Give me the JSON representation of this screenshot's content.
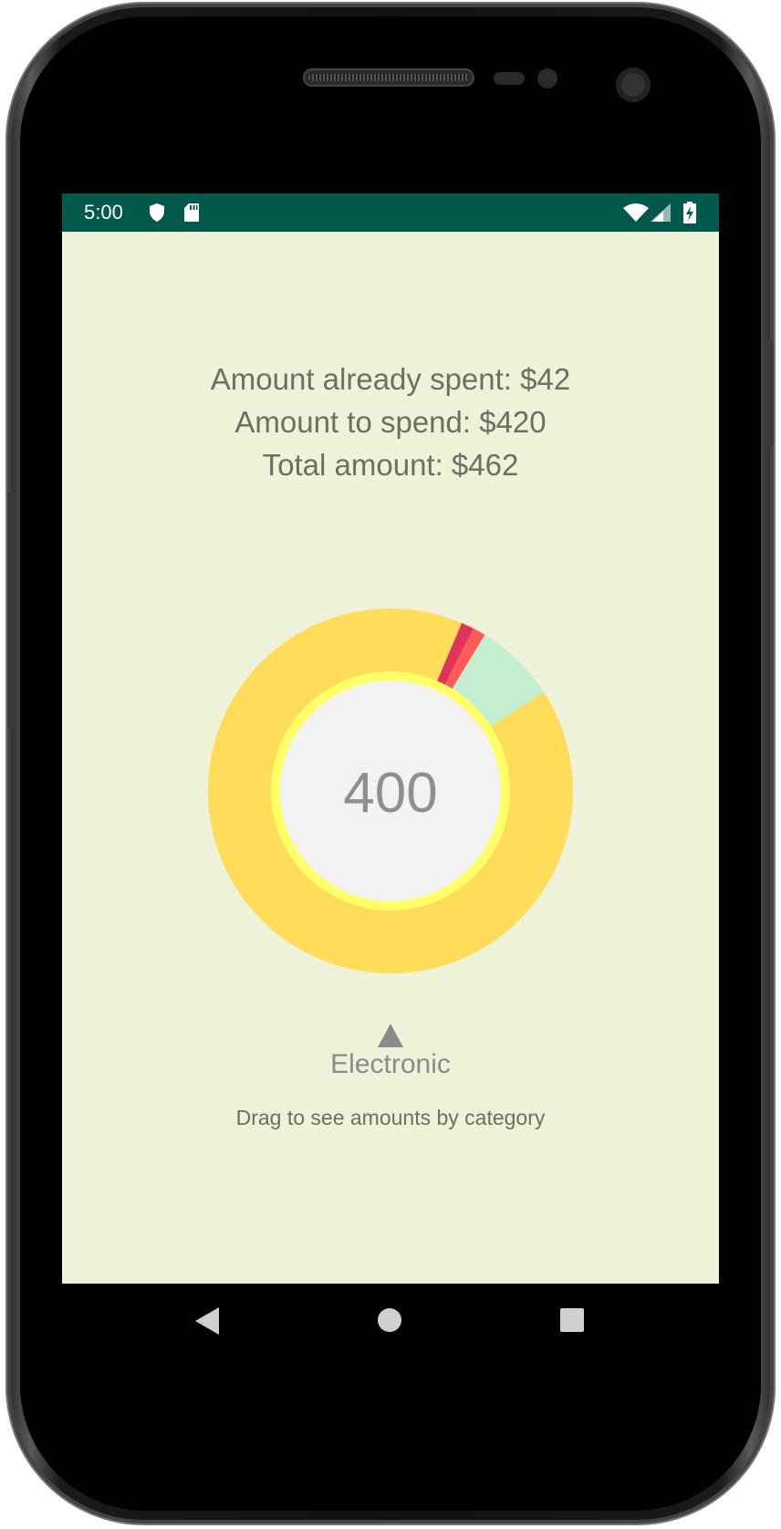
{
  "status_bar": {
    "time": "5:00",
    "background": "#00594b",
    "icons": [
      "shield-icon",
      "sd-card-icon",
      "wifi-icon",
      "signal-icon",
      "battery-charging-icon"
    ]
  },
  "summary": {
    "spent": "Amount already spent: $42",
    "to_spend": "Amount to spend: $420",
    "total": "Total amount: $462"
  },
  "chart_data": {
    "type": "pie",
    "style": "donut",
    "center_value": "400",
    "selected_category": "Electronic",
    "segments": [
      {
        "name": "Electronic",
        "value": 400,
        "color": "#ffdc5a"
      },
      {
        "name": "",
        "value": 5,
        "color": "#e0325a"
      },
      {
        "name": "",
        "value": 5,
        "color": "#ff5c59"
      },
      {
        "name": "",
        "value": 32,
        "color": "#c5edd0"
      }
    ],
    "inner_ring_color": "#ffff66",
    "center_color": "#f2f2f2"
  },
  "hint": "Drag to see amounts by category",
  "nav_bar": {
    "buttons": [
      "back-icon",
      "home-icon",
      "recents-icon"
    ]
  },
  "colors": {
    "screen_background": "#eef2d9",
    "text": "#6d6f64"
  }
}
